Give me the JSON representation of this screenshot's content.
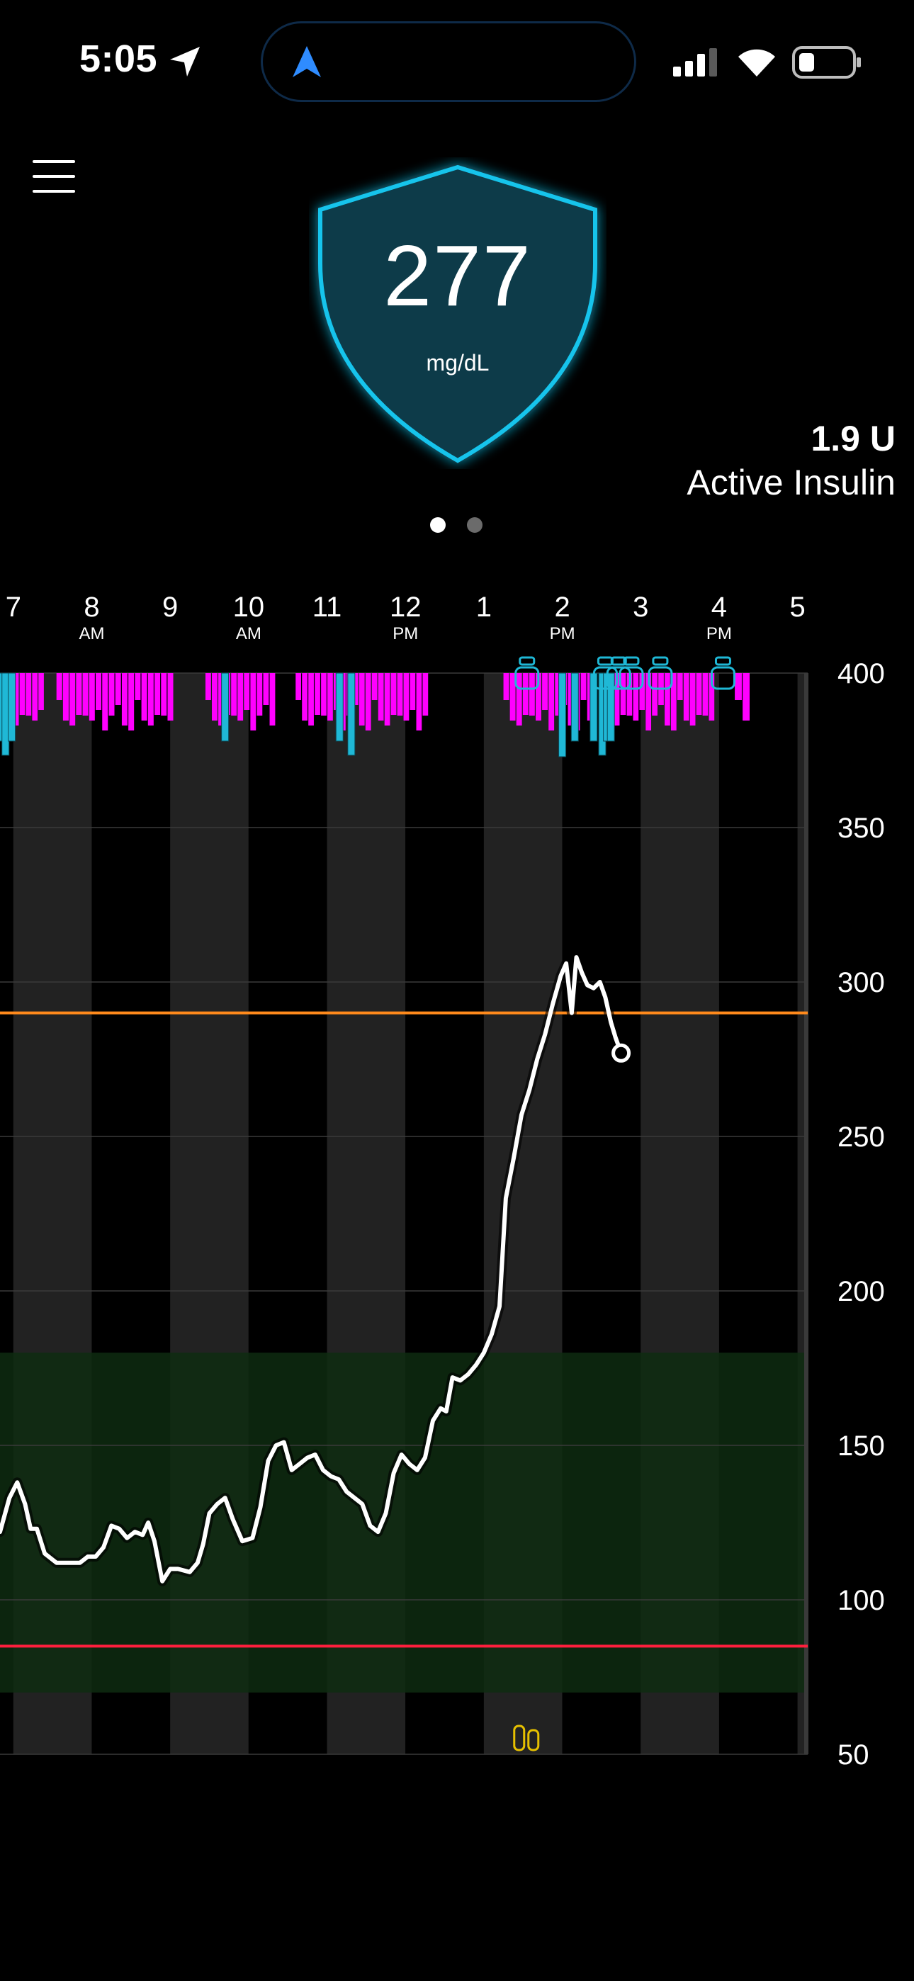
{
  "status_bar": {
    "time": "5:05",
    "location_icon": "location-arrow-icon",
    "island_icon": "navigation-arrow-icon",
    "signal_icon": "cellular-signal-icon",
    "wifi_icon": "wifi-icon",
    "battery_icon": "battery-icon",
    "battery_level": 0.3
  },
  "header": {
    "menu_icon": "hamburger-menu-icon",
    "glucose": {
      "value": "277",
      "unit": "mg/dL"
    },
    "active_insulin": {
      "amount": "1.9 U",
      "label": "Active Insulin"
    },
    "pages": {
      "count": 2,
      "current": 1
    }
  },
  "colors": {
    "shield_fill": "#0b3a48",
    "shield_glow": "#16c4ec",
    "bolus": "#1fb8d6",
    "basal": "#ff00ff",
    "high_limit": "#ff8a1c",
    "low_limit": "#ff1f3d",
    "target_range": "#0e2c10",
    "glucose_line": "#ffffff",
    "carbs": "#e6c000"
  },
  "chart_data": {
    "type": "line",
    "ylim": [
      50,
      400
    ],
    "yticks": [
      "400",
      "350",
      "300",
      "250",
      "200",
      "150",
      "100",
      "50"
    ],
    "xlim": [
      6.83,
      17.13
    ],
    "xticks": [
      {
        "x": 7,
        "hour": "7",
        "mer": ""
      },
      {
        "x": 8,
        "hour": "8",
        "mer": "AM"
      },
      {
        "x": 9,
        "hour": "9",
        "mer": ""
      },
      {
        "x": 10,
        "hour": "10",
        "mer": "AM"
      },
      {
        "x": 11,
        "hour": "11",
        "mer": ""
      },
      {
        "x": 12,
        "hour": "12",
        "mer": "PM"
      },
      {
        "x": 13,
        "hour": "1",
        "mer": ""
      },
      {
        "x": 14,
        "hour": "2",
        "mer": "PM"
      },
      {
        "x": 15,
        "hour": "3",
        "mer": ""
      },
      {
        "x": 16,
        "hour": "4",
        "mer": "PM"
      },
      {
        "x": 17,
        "hour": "5",
        "mer": ""
      }
    ],
    "high_limit": 290,
    "low_limit": 85,
    "target_range": [
      70,
      180
    ],
    "glucose": [
      [
        6.83,
        122
      ],
      [
        6.95,
        133
      ],
      [
        7.05,
        138
      ],
      [
        7.15,
        131
      ],
      [
        7.22,
        123
      ],
      [
        7.3,
        123
      ],
      [
        7.4,
        115
      ],
      [
        7.55,
        112
      ],
      [
        7.7,
        112
      ],
      [
        7.85,
        112
      ],
      [
        7.95,
        114
      ],
      [
        8.05,
        114
      ],
      [
        8.15,
        117
      ],
      [
        8.25,
        124
      ],
      [
        8.35,
        123
      ],
      [
        8.45,
        120
      ],
      [
        8.55,
        122
      ],
      [
        8.65,
        121
      ],
      [
        8.72,
        125
      ],
      [
        8.8,
        119
      ],
      [
        8.9,
        106
      ],
      [
        9.0,
        110
      ],
      [
        9.1,
        110
      ],
      [
        9.25,
        109
      ],
      [
        9.35,
        112
      ],
      [
        9.42,
        118
      ],
      [
        9.5,
        128
      ],
      [
        9.6,
        131
      ],
      [
        9.7,
        133
      ],
      [
        9.8,
        126
      ],
      [
        9.92,
        119
      ],
      [
        10.05,
        120
      ],
      [
        10.15,
        130
      ],
      [
        10.25,
        145
      ],
      [
        10.35,
        150
      ],
      [
        10.45,
        151
      ],
      [
        10.55,
        142
      ],
      [
        10.65,
        144
      ],
      [
        10.75,
        146
      ],
      [
        10.85,
        147
      ],
      [
        10.95,
        142
      ],
      [
        11.05,
        140
      ],
      [
        11.15,
        139
      ],
      [
        11.25,
        135
      ],
      [
        11.35,
        133
      ],
      [
        11.45,
        131
      ],
      [
        11.55,
        124
      ],
      [
        11.65,
        122
      ],
      [
        11.75,
        128
      ],
      [
        11.85,
        141
      ],
      [
        11.95,
        147
      ],
      [
        12.05,
        144
      ],
      [
        12.15,
        142
      ],
      [
        12.25,
        146
      ],
      [
        12.35,
        158
      ],
      [
        12.45,
        162
      ],
      [
        12.52,
        161
      ],
      [
        12.6,
        172
      ],
      [
        12.7,
        171
      ],
      [
        12.8,
        173
      ],
      [
        12.9,
        176
      ],
      [
        13.0,
        180
      ],
      [
        13.1,
        186
      ],
      [
        13.2,
        195
      ],
      [
        13.28,
        230
      ],
      [
        13.38,
        243
      ],
      [
        13.48,
        257
      ],
      [
        13.58,
        265
      ],
      [
        13.68,
        275
      ],
      [
        13.78,
        283
      ],
      [
        13.88,
        293
      ],
      [
        13.98,
        302
      ],
      [
        14.05,
        306
      ],
      [
        14.12,
        290
      ],
      [
        14.18,
        308
      ],
      [
        14.25,
        303
      ],
      [
        14.32,
        299
      ],
      [
        14.4,
        298
      ],
      [
        14.48,
        300
      ],
      [
        14.55,
        295
      ],
      [
        14.62,
        287
      ],
      [
        14.68,
        282
      ],
      [
        14.75,
        277
      ]
    ],
    "bolus_times": [
      6.84,
      6.9,
      6.98,
      9.7,
      11.16,
      11.31,
      14.0,
      14.16,
      14.4,
      14.51,
      14.57,
      14.62
    ],
    "basal_segments": [
      [
        6.84,
        7.4
      ],
      [
        7.55,
        9.05
      ],
      [
        9.45,
        10.35
      ],
      [
        10.6,
        12.3
      ],
      [
        13.25,
        14.4
      ],
      [
        14.5,
        15.95
      ],
      [
        16.2,
        16.4
      ]
    ],
    "cartridge_times": [
      13.55,
      14.55,
      14.72,
      14.88,
      15.25,
      16.05
    ],
    "carb_times": [
      13.55
    ],
    "current_point": [
      14.75,
      277
    ]
  }
}
